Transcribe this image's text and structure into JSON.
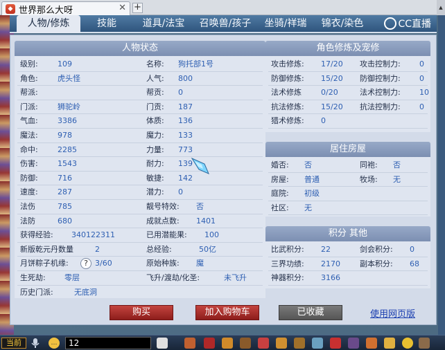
{
  "browser": {
    "tab_title": "世界那么大呀",
    "tab_icon": "game-icon",
    "close_symbol": "✕",
    "new_tab_symbol": "+"
  },
  "nav": {
    "tabs": [
      "人物/修炼",
      "技能",
      "道具/法宝",
      "召唤兽/孩子",
      "坐骑/祥瑞",
      "锦衣/染色"
    ],
    "active": "人物/修炼",
    "logo_text": "CC直播"
  },
  "status": {
    "title": "人物状态",
    "left": [
      {
        "label": "级别:",
        "value": "109"
      },
      {
        "label": "角色:",
        "value": "虎头怪"
      },
      {
        "label": "帮派:",
        "value": ""
      },
      {
        "label": "门派:",
        "value": "狮驼岭"
      },
      {
        "label": "气血:",
        "value": "3386"
      },
      {
        "label": "魔法:",
        "value": "978"
      },
      {
        "label": "命中:",
        "value": "2285"
      },
      {
        "label": "伤害:",
        "value": "1543"
      },
      {
        "label": "防御:",
        "value": "716"
      },
      {
        "label": "速度:",
        "value": "287"
      },
      {
        "label": "法伤",
        "value": "785"
      },
      {
        "label": "法防",
        "value": "680"
      },
      {
        "label": "获得经验:",
        "value": "340122311"
      },
      {
        "label": "新版乾元丹数量",
        "value": "2"
      },
      {
        "label": "月饼粽子机缘:",
        "value": "3/60"
      },
      {
        "label": "生死劫:",
        "value": "零层"
      },
      {
        "label": "历史门派:",
        "value": "无底洞"
      }
    ],
    "right": [
      {
        "label": "名称:",
        "value": "狗托部1号"
      },
      {
        "label": "人气:",
        "value": "800"
      },
      {
        "label": "帮贡:",
        "value": "0"
      },
      {
        "label": "门贡:",
        "value": "187"
      },
      {
        "label": "体质:",
        "value": "136"
      },
      {
        "label": "魔力:",
        "value": "133"
      },
      {
        "label": "力量:",
        "value": "773"
      },
      {
        "label": "耐力:",
        "value": "139"
      },
      {
        "label": "敏捷:",
        "value": "142"
      },
      {
        "label": "潜力:",
        "value": "0"
      },
      {
        "label": "靓号特效:",
        "value": "否"
      },
      {
        "label": "成就点数:",
        "value": "1401"
      },
      {
        "label": "已用潜能果:",
        "value": "100"
      },
      {
        "label": "总经验:",
        "value": "50亿"
      },
      {
        "label": "原始种族:",
        "value": "魔"
      },
      {
        "label": "飞升/渡劫/化圣:",
        "value": "未飞升"
      }
    ],
    "qmark_symbol": "?"
  },
  "training": {
    "title": "角色修炼及宠修",
    "rows": [
      {
        "l_label": "攻击修炼:",
        "l_value": "17/20",
        "r_label": "攻击控制力:",
        "r_value": "0"
      },
      {
        "l_label": "防御修炼:",
        "l_value": "15/20",
        "r_label": "防御控制力:",
        "r_value": "0"
      },
      {
        "l_label": "法术修炼",
        "l_value": "0/20",
        "r_label": "法术控制力:",
        "r_value": "10"
      },
      {
        "l_label": "抗法修炼:",
        "l_value": "15/20",
        "r_label": "抗法控制力:",
        "r_value": "0"
      },
      {
        "l_label": "猎术修炼:",
        "l_value": "0",
        "r_label": "",
        "r_value": ""
      }
    ]
  },
  "housing": {
    "title": "居住房屋",
    "rows": [
      {
        "l_label": "婚否:",
        "l_value": "否",
        "r_label": "同袍:",
        "r_value": "否"
      },
      {
        "l_label": "房屋:",
        "l_value": "普通",
        "r_label": "牧场:",
        "r_value": "无"
      },
      {
        "l_label": "庭院:",
        "l_value": "初级",
        "r_label": "",
        "r_value": ""
      },
      {
        "l_label": "社区:",
        "l_value": "无",
        "r_label": "",
        "r_value": ""
      }
    ]
  },
  "points": {
    "title": "积分 其他",
    "rows": [
      {
        "l_label": "比武积分:",
        "l_value": "22",
        "r_label": "剑会积分:",
        "r_value": "0"
      },
      {
        "l_label": "三界功绩:",
        "l_value": "2170",
        "r_label": "副本积分:",
        "r_value": "68"
      },
      {
        "l_label": "神器积分:",
        "l_value": "3166",
        "r_label": "",
        "r_value": ""
      }
    ]
  },
  "actions": {
    "buy": "购买",
    "cart": "加入购物车",
    "favorited": "已收藏",
    "web_version": "使用网页版"
  },
  "taskbar": {
    "current": "当前",
    "channel_value": "12",
    "colors": {
      "accent_gold": "#ffcc3a",
      "button_red": "#a62a27",
      "value_blue": "#2e5fb2"
    }
  }
}
